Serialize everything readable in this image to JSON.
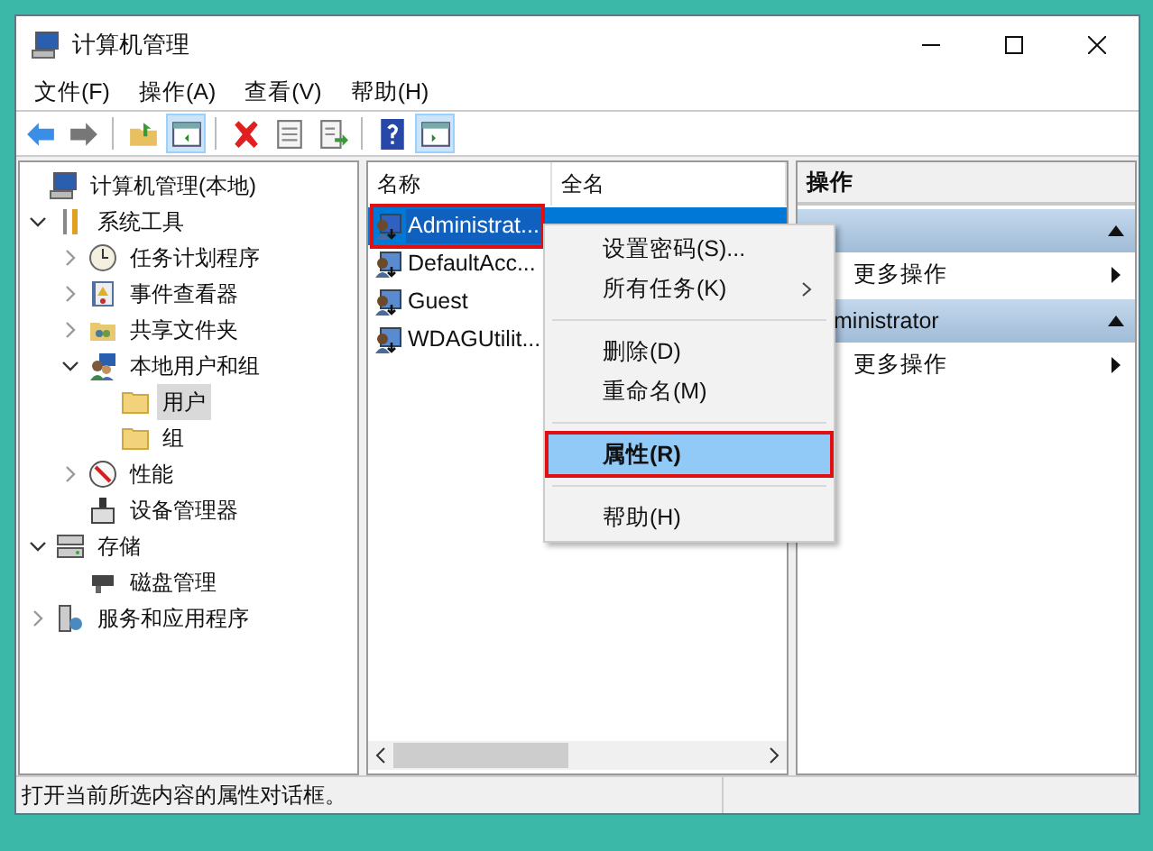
{
  "window": {
    "title": "计算机管理"
  },
  "menu": [
    {
      "label": "文件(F)"
    },
    {
      "label": "操作(A)"
    },
    {
      "label": "查看(V)"
    },
    {
      "label": "帮助(H)"
    }
  ],
  "toolbar": [
    [
      {
        "selected": false
      },
      {
        "selected": false
      }
    ],
    [
      {
        "selected": false
      },
      {
        "selected": true
      }
    ],
    [
      {
        "selected": false
      },
      {
        "selected": false
      },
      {
        "selected": false
      }
    ],
    [
      {
        "selected": false
      },
      {
        "selected": true
      }
    ]
  ],
  "tree": [
    {
      "label": "计算机管理(本地)",
      "selected": false,
      "children": [
        {
          "label": "系统工具",
          "expanded": true,
          "selected": false,
          "children": [
            {
              "label": "任务计划程序",
              "expanded": false,
              "selected": false
            },
            {
              "label": "事件查看器",
              "expanded": false,
              "selected": false
            },
            {
              "label": "共享文件夹",
              "expanded": false,
              "selected": false
            },
            {
              "label": "本地用户和组",
              "expanded": true,
              "selected": false,
              "children": [
                {
                  "label": "用户",
                  "selected": true
                },
                {
                  "label": "组",
                  "selected": false
                }
              ]
            },
            {
              "label": "性能",
              "expanded": false,
              "selected": false
            },
            {
              "label": "设备管理器",
              "selected": false
            }
          ]
        },
        {
          "label": "存储",
          "expanded": true,
          "selected": false,
          "children": [
            {
              "label": "磁盘管理",
              "selected": false
            }
          ]
        },
        {
          "label": "服务和应用程序",
          "expanded": false,
          "selected": false
        }
      ]
    }
  ],
  "list": {
    "columns": [
      "名称",
      "全名"
    ],
    "rows": [
      {
        "name": "Administrat...",
        "selected": true,
        "outlined": true
      },
      {
        "name": "DefaultAcc...",
        "selected": false,
        "outlined": false
      },
      {
        "name": "Guest",
        "selected": false,
        "outlined": false
      },
      {
        "name": "WDAGUtilit...",
        "selected": false,
        "outlined": false
      }
    ]
  },
  "context_menu": [
    {
      "kind": "item",
      "label": "设置密码(S)...",
      "selected": false,
      "submenu": false,
      "default": false,
      "outlined": false
    },
    {
      "kind": "item",
      "label": "所有任务(K)",
      "selected": false,
      "submenu": true,
      "default": false,
      "outlined": false
    },
    {
      "kind": "separator"
    },
    {
      "kind": "item",
      "label": "删除(D)",
      "selected": false,
      "submenu": false,
      "default": false,
      "outlined": false
    },
    {
      "kind": "item",
      "label": "重命名(M)",
      "selected": false,
      "submenu": false,
      "default": false,
      "outlined": false
    },
    {
      "kind": "separator"
    },
    {
      "kind": "item",
      "label": "属性(R)",
      "selected": true,
      "submenu": false,
      "default": true,
      "outlined": true
    },
    {
      "kind": "separator"
    },
    {
      "kind": "item",
      "label": "帮助(H)",
      "selected": false,
      "submenu": false,
      "default": false,
      "outlined": false
    }
  ],
  "actions": {
    "title": "操作",
    "sections": [
      {
        "expanded": true,
        "items": [
          {
            "label": "更多操作"
          }
        ]
      },
      {
        "header": "ministrator",
        "expanded": true,
        "items": [
          {
            "label": "更多操作"
          }
        ]
      }
    ]
  },
  "status_bar": {
    "text": "打开当前所选内容的属性对话框。"
  }
}
